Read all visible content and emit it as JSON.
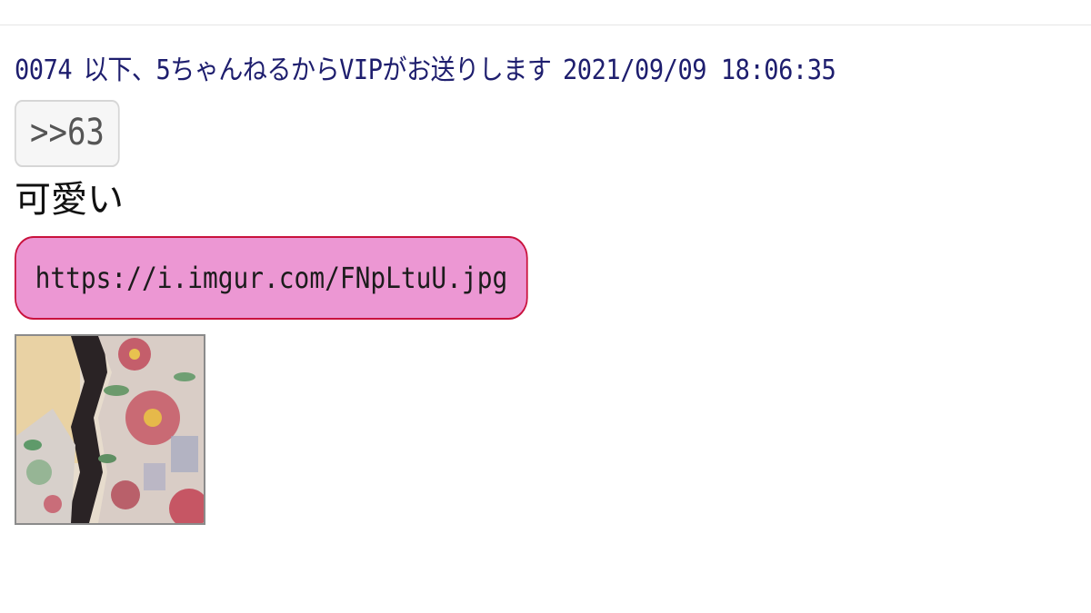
{
  "post": {
    "number": "0074",
    "name": "以下、5ちゃんねるからVIPがお送りします",
    "datetime": "2021/09/09 18:06:35",
    "reply_anchor": ">>63",
    "message": "可愛い",
    "image_link": "https://i.imgur.com/FNpLtuU.jpg"
  }
}
